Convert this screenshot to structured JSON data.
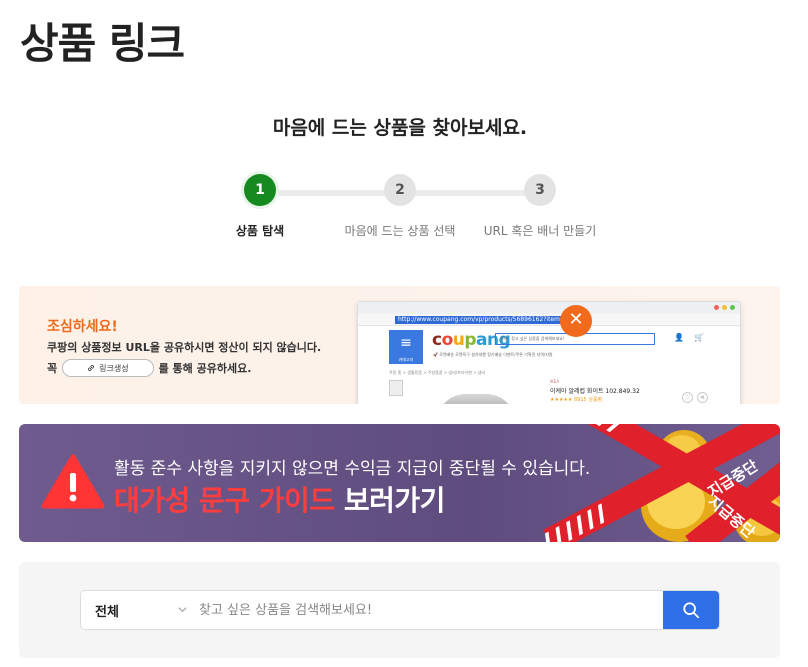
{
  "page": {
    "title": "상품 링크",
    "subtitle": "마음에 드는 상품을 찾아보세요."
  },
  "steps": [
    {
      "number": "1",
      "label": "상품 탐색",
      "active": true
    },
    {
      "number": "2",
      "label": "마음에 드는 상품 선택",
      "active": false
    },
    {
      "number": "3",
      "label": "URL 혹은 배너 만들기",
      "active": false
    }
  ],
  "caution_banner": {
    "title": "조심하세요!",
    "line1": "쿠팡의 상품정보 URL을 공유하시면 정산이 되지 않습니다.",
    "line2_prefix": "꼭",
    "pill_label": "링크생성",
    "line2_suffix": "를 통해 공유하세요.",
    "mock_browser": {
      "url": "http://www.coupang.com/vp/products/56896162?itemId",
      "logo": "coupang",
      "menu_label": "카테고리",
      "search_placeholder": "찾고 싶은 상품을 검색해보세요!",
      "search_category": "전체",
      "categories": "🚀 로켓배송   로켓직구   설치대행   정기배송   이벤트/쿠폰   기획전   지역/지원",
      "breadcrumb": "쿠팡 홈 > 생활용품 > 주방용품 > 냄비/프라이팬 > 냄비",
      "brand": "IKEA",
      "product_name": "이케아 알레컵 화이트 102.849.32",
      "rating_text": "★★★★★ 8915 상품평",
      "icon_user_label": "마이쿠팡",
      "icon_cart_label": "장바구니"
    },
    "colors": {
      "accent": "#ef6a1a"
    }
  },
  "guide_banner": {
    "line1": "활동 준수 사항을 지키지 않으면 수익금 지급이 중단될 수 있습니다.",
    "line2_highlight": "대가성 문구 가이드",
    "line2_rest": " 보러가기",
    "tape_texts": [
      "지급중단",
      "지급중단"
    ],
    "colors": {
      "highlight": "#ff3d3d",
      "tape": "#e0202a"
    }
  },
  "search": {
    "category": "전체",
    "placeholder": "찾고 싶은 상품을 검색해보세요!",
    "value": "",
    "colors": {
      "button": "#2f6fe8"
    }
  }
}
